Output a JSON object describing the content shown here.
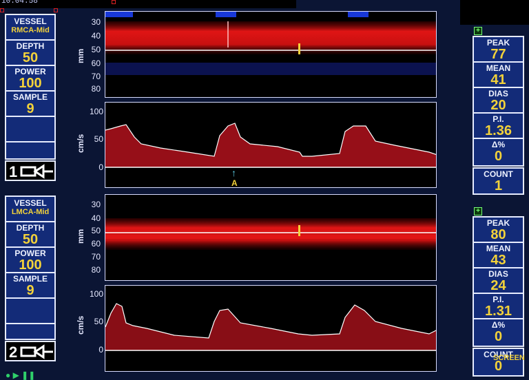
{
  "clock": "10:04:58",
  "channel1": {
    "number": "1",
    "vessel_label": "VESSEL",
    "vessel_value": "RMCA-Mid",
    "depth_label": "DEPTH",
    "depth_value": "50",
    "power_label": "POWER",
    "power_value": "100",
    "sample_label": "SAMPLE",
    "sample_value": "9",
    "stats": {
      "peak_label": "PEAK",
      "peak": "77",
      "mean_label": "MEAN",
      "mean": "41",
      "dias_label": "DIAS",
      "dias": "20",
      "pi_label": "P.I.",
      "pi": "1.36",
      "delta_label": "Δ%",
      "delta": "0"
    },
    "count_label": "COUNT",
    "count": "1",
    "annotation": "A"
  },
  "channel2": {
    "number": "2",
    "vessel_label": "VESSEL",
    "vessel_value": "LMCA-Mid",
    "depth_label": "DEPTH",
    "depth_value": "50",
    "power_label": "POWER",
    "power_value": "100",
    "sample_label": "SAMPLE",
    "sample_value": "9",
    "stats": {
      "peak_label": "PEAK",
      "peak": "80",
      "mean_label": "MEAN",
      "mean": "43",
      "dias_label": "DIAS",
      "dias": "24",
      "pi_label": "P.I.",
      "pi": "1.31",
      "delta_label": "Δ%",
      "delta": "0"
    },
    "count_label": "COUNT",
    "count": "0"
  },
  "axes": {
    "mmode_unit": "mm",
    "mmode_ticks": [
      "30",
      "40",
      "50",
      "60",
      "70",
      "80"
    ],
    "spectrum_unit": "cm/s",
    "spectrum_ticks": [
      "100",
      "50",
      "0"
    ]
  },
  "screen_label": "SCREEN",
  "colors": {
    "panel_bg": "#132b78",
    "value": "#f3d23a",
    "flow_toward": "#e01515",
    "flow_away": "#1838d8",
    "envelope": "#ffffff"
  }
}
